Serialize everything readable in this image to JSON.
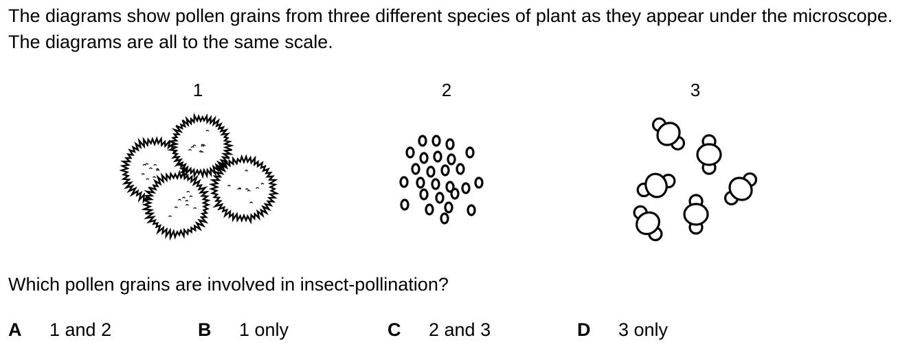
{
  "stem": {
    "intro": "The diagrams show pollen grains from three different species of plant as they appear under the microscope. The diagrams are all to the same scale.",
    "question": "Which pollen grains are involved in insect-pollination?"
  },
  "figures": [
    {
      "label": "1",
      "icon": "spiky-pollen-grains"
    },
    {
      "label": "2",
      "icon": "small-smooth-pollen-grains"
    },
    {
      "label": "3",
      "icon": "winged-pollen-grains"
    }
  ],
  "options": [
    {
      "letter": "A",
      "text": "1 and 2"
    },
    {
      "letter": "B",
      "text": "1 only"
    },
    {
      "letter": "C",
      "text": "2 and 3"
    },
    {
      "letter": "D",
      "text": "3 only"
    }
  ]
}
